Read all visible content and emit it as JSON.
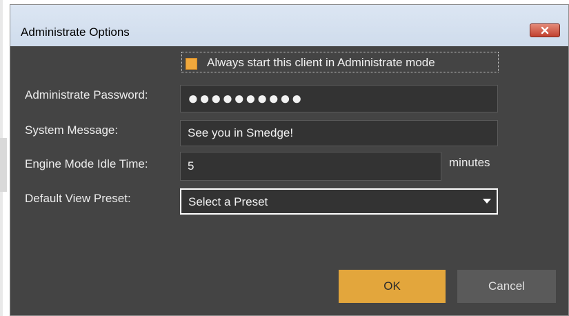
{
  "window": {
    "title": "Administrate Options",
    "close_icon": "close-icon"
  },
  "form": {
    "always_start_label": "Always start this client in Administrate mode",
    "always_start_checked": true,
    "password_label": "Administrate Password:",
    "password_value": "●●●●●●●●●●",
    "system_message_label": "System Message:",
    "system_message_value": "See you in Smedge!",
    "idle_time_label": "Engine Mode Idle Time:",
    "idle_time_value": "5",
    "idle_time_unit": "minutes",
    "view_preset_label": "Default View Preset:",
    "view_preset_value": "Select a Preset"
  },
  "buttons": {
    "ok_label": "OK",
    "cancel_label": "Cancel"
  },
  "colors": {
    "dialog_background": "#444444",
    "field_background": "#333333",
    "accent_orange": "#e3a63c",
    "titlebar": "#d5e0ee"
  }
}
